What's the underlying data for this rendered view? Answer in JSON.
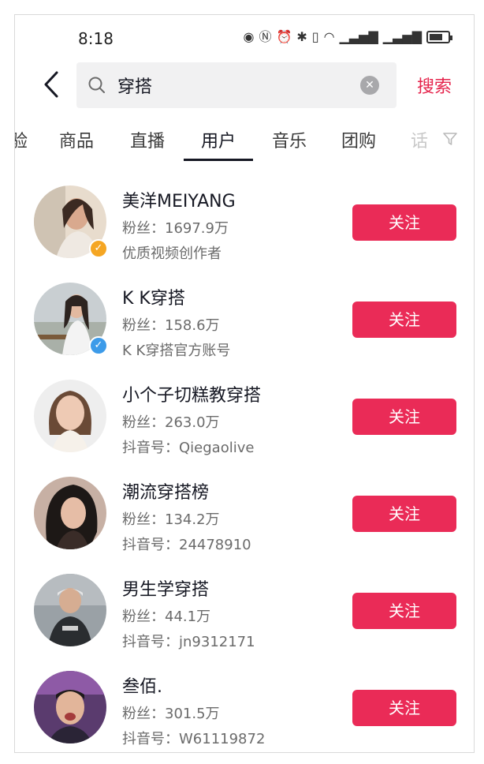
{
  "status_bar": {
    "time": "8:18",
    "icons": [
      "eye-icon",
      "nfc-icon",
      "alarm-icon",
      "bluetooth-icon",
      "vibrate-icon",
      "wifi-icon",
      "signal-4g-icon",
      "signal-4g-icon",
      "battery-icon"
    ]
  },
  "search": {
    "query": "穿搭",
    "submit_label": "搜索"
  },
  "tabs": [
    {
      "label": "验"
    },
    {
      "label": "商品"
    },
    {
      "label": "直播"
    },
    {
      "label": "用户",
      "active": true
    },
    {
      "label": "音乐"
    },
    {
      "label": "团购"
    },
    {
      "label": "话"
    }
  ],
  "colors": {
    "accent": "#ea2b57",
    "search_accent": "#e5244c",
    "badge_gold": "#f5a623",
    "badge_blue": "#3d9be9"
  },
  "users": [
    {
      "name": "美洋MEIYANG",
      "fans": "粉丝：1697.9万",
      "desc": "优质视频创作者",
      "badge": "gold",
      "follow_label": "关注"
    },
    {
      "name": "K K穿搭",
      "fans": "粉丝：158.6万",
      "desc": "K K穿搭官方账号",
      "badge": "blue",
      "follow_label": "关注"
    },
    {
      "name": "小个子切糕教穿搭",
      "fans": "粉丝：263.0万",
      "desc": "抖音号：Qiegaolive",
      "badge": "",
      "follow_label": "关注"
    },
    {
      "name": "潮流穿搭榜",
      "fans": "粉丝：134.2万",
      "desc": "抖音号：24478910",
      "badge": "",
      "follow_label": "关注"
    },
    {
      "name": "男生学穿搭",
      "fans": "粉丝：44.1万",
      "desc": "抖音号：jn9312171",
      "badge": "",
      "follow_label": "关注"
    },
    {
      "name": "叁佰.",
      "fans": "粉丝：301.5万",
      "desc": "抖音号：W61119872",
      "badge": "",
      "follow_label": "关注"
    }
  ]
}
